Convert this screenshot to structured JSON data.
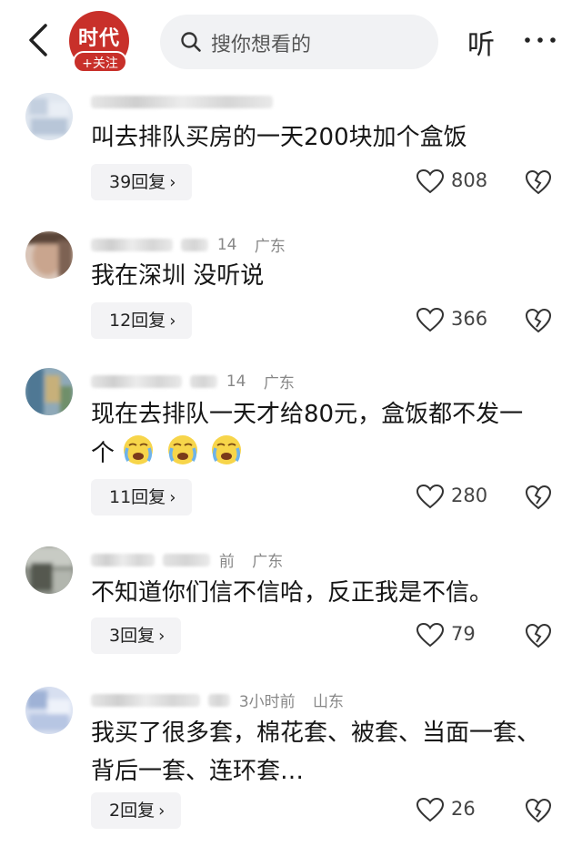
{
  "header": {
    "logo_text": "时代",
    "follow_label": "+关注",
    "search_placeholder": "搜你想看的",
    "listen_label": "听",
    "back_icon": "chevron-left-icon",
    "more_icon": "more-dots-icon"
  },
  "comments": [
    {
      "name_masked": true,
      "time": "",
      "location": "",
      "text": "叫去排队买房的一天200块加个盒饭",
      "reply_label": "39回复",
      "likes": "808"
    },
    {
      "name_masked": true,
      "time": "14",
      "location": "广东",
      "text": "我在深圳 没听说",
      "reply_label": "12回复",
      "likes": "366"
    },
    {
      "name_masked": true,
      "time": "14",
      "location": "广东",
      "text_line1": "现在去排队一天才给80元，盒饭都不发一",
      "text_line2": "个",
      "emoji": "crying-face-icon",
      "reply_label": "11回复",
      "likes": "280"
    },
    {
      "name_masked": true,
      "time": "前",
      "location": "广东",
      "text": "不知道你们信不信哈，反正我是不信。",
      "reply_label": "3回复",
      "likes": "79"
    },
    {
      "name_masked": true,
      "time": "3小时前",
      "location": "山东",
      "text_line1": "我买了很多套，棉花套、被套、当面一套、",
      "text_line2": "背后一套、连环套…",
      "reply_label": "2回复",
      "likes": "26"
    }
  ],
  "colors": {
    "brand_red": "#c8302a",
    "text": "#161616",
    "meta": "#888888",
    "chip_bg": "#f3f3f5"
  }
}
